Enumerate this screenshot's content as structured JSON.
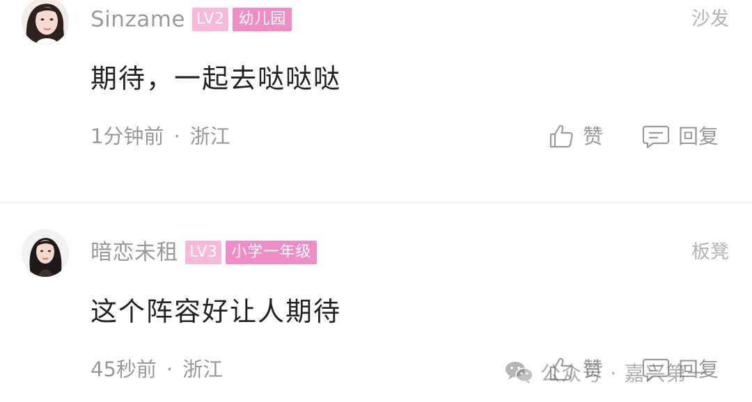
{
  "comments": [
    {
      "username": "Sinzame",
      "level": "LV2",
      "grade": "幼儿园",
      "floor": "沙发",
      "text": "期待，一起去哒哒哒",
      "time": "1分钟前",
      "location": "浙江",
      "like_label": "赞",
      "reply_label": "回复"
    },
    {
      "username": "暗恋未租",
      "level": "LV3",
      "grade": "小学一年级",
      "floor": "板凳",
      "text": "这个阵容好让人期待",
      "time": "45秒前",
      "location": "浙江",
      "like_label": "赞",
      "reply_label": "回复"
    }
  ],
  "meta_separator": "·",
  "watermark": {
    "icon": "wechat-icon",
    "text": "公众号 · 嘉兴第一"
  },
  "colors": {
    "level_badge": "#f7b9d8",
    "grade_badge": "#ef8ec4",
    "username": "#9a9a9a",
    "comment_text": "#222222",
    "meta_text": "#999999"
  },
  "icons": {
    "like": "thumbs-up-icon",
    "reply": "comment-bubble-icon"
  }
}
